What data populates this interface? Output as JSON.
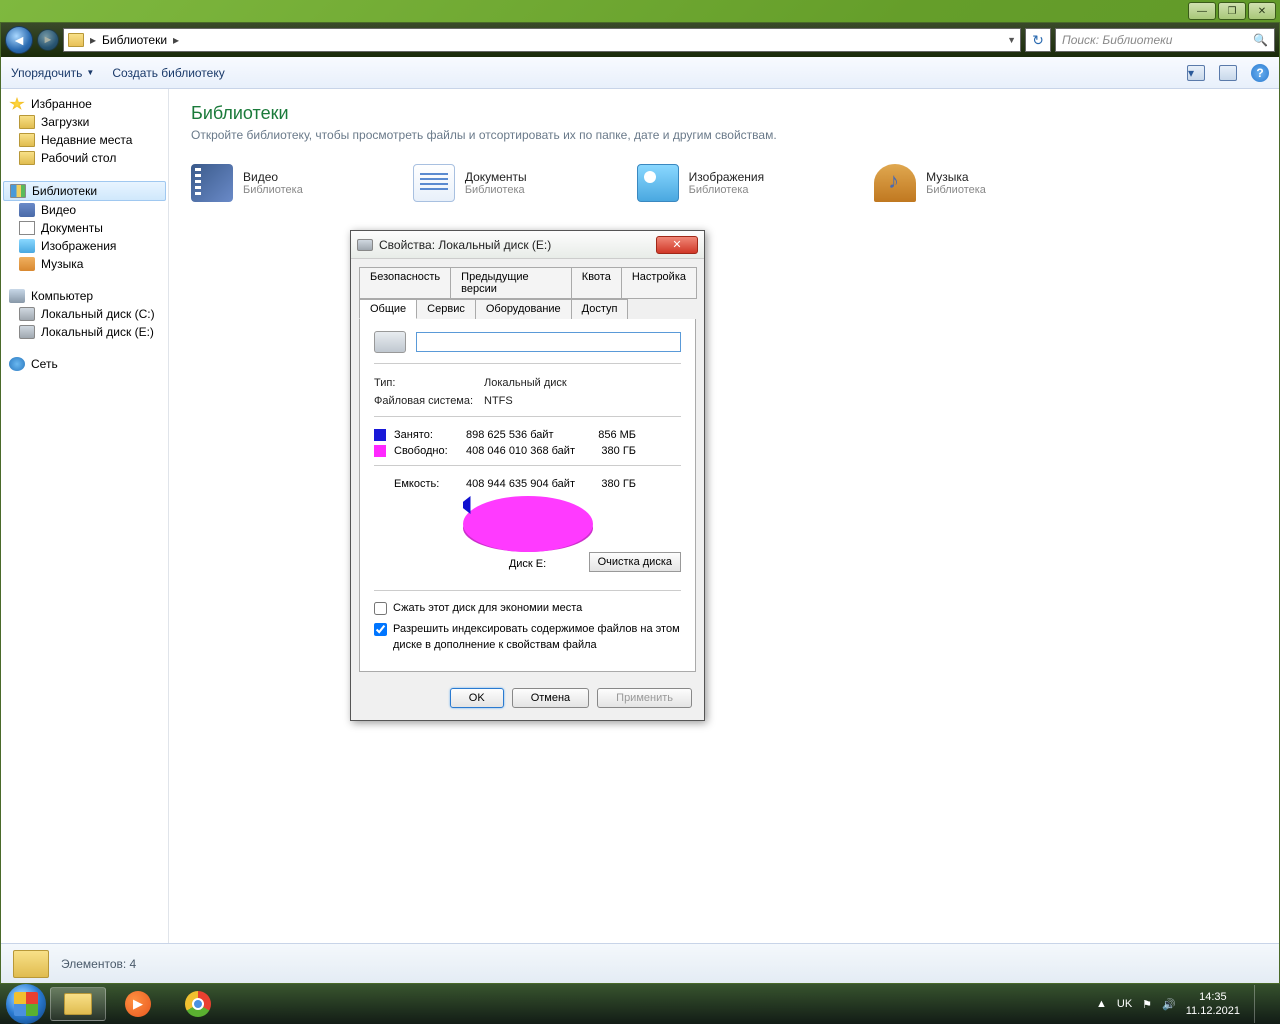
{
  "window_controls": {
    "min": "—",
    "max": "❐",
    "close": "✕"
  },
  "nav": {
    "breadcrumb_root": "Библиотеки",
    "search_placeholder": "Поиск: Библиотеки"
  },
  "toolbar": {
    "organize": "Упорядочить",
    "new_lib": "Создать библиотеку"
  },
  "sidebar": {
    "favorites": {
      "head": "Избранное",
      "items": [
        "Загрузки",
        "Недавние места",
        "Рабочий стол"
      ]
    },
    "libraries": {
      "head": "Библиотеки",
      "items": [
        "Видео",
        "Документы",
        "Изображения",
        "Музыка"
      ]
    },
    "computer": {
      "head": "Компьютер",
      "items": [
        "Локальный диск (C:)",
        "Локальный диск (E:)"
      ]
    },
    "network": {
      "head": "Сеть"
    }
  },
  "main": {
    "title": "Библиотеки",
    "subtitle": "Откройте библиотеку, чтобы просмотреть файлы и отсортировать их по папке, дате и другим свойствам.",
    "lib_type": "Библиотека",
    "items": [
      "Видео",
      "Документы",
      "Изображения",
      "Музыка"
    ]
  },
  "statusbar": {
    "count": "Элементов: 4"
  },
  "dialog": {
    "title": "Свойства: Локальный диск (E:)",
    "tabs_top": [
      "Безопасность",
      "Предыдущие версии",
      "Квота",
      "Настройка"
    ],
    "tabs_bottom": [
      "Общие",
      "Сервис",
      "Оборудование",
      "Доступ"
    ],
    "type_lbl": "Тип:",
    "type_val": "Локальный диск",
    "fs_lbl": "Файловая система:",
    "fs_val": "NTFS",
    "used_lbl": "Занято:",
    "used_bytes": "898 625 536 байт",
    "used_size": "856 МБ",
    "used_color": "#1818d8",
    "free_lbl": "Свободно:",
    "free_bytes": "408 046 010 368 байт",
    "free_size": "380 ГБ",
    "free_color": "#ff28ff",
    "cap_lbl": "Емкость:",
    "cap_bytes": "408 944 635 904 байт",
    "cap_size": "380 ГБ",
    "disk_label": "Диск E:",
    "cleanup": "Очистка диска",
    "compress": "Сжать этот диск для экономии места",
    "index": "Разрешить индексировать содержимое файлов на этом диске в дополнение к свойствам файла",
    "ok": "OK",
    "cancel": "Отмена",
    "apply": "Применить"
  },
  "taskbar": {
    "lang": "UK",
    "time": "14:35",
    "date": "11.12.2021"
  },
  "chart_data": {
    "type": "pie",
    "title": "Диск E:",
    "series": [
      {
        "name": "Занято",
        "value": 898625536,
        "display": "856 МБ",
        "color": "#1818d8"
      },
      {
        "name": "Свободно",
        "value": 408046010368,
        "display": "380 ГБ",
        "color": "#ff28ff"
      }
    ],
    "total": {
      "name": "Емкость",
      "value": 408944635904,
      "display": "380 ГБ"
    }
  }
}
